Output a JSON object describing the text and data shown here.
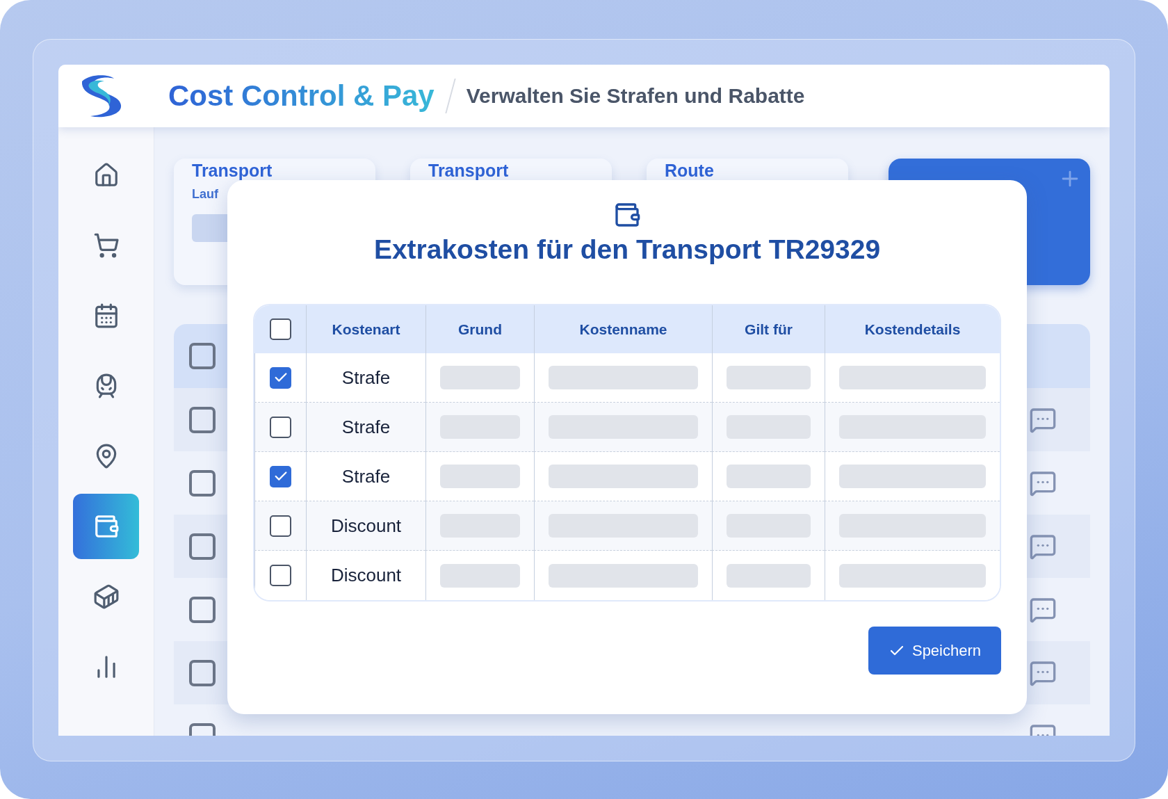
{
  "header": {
    "title": "Cost Control & Pay",
    "subtitle": "Verwalten Sie Strafen und Rabatte"
  },
  "sidebar": {
    "items": [
      {
        "selected": false
      },
      {
        "selected": false
      },
      {
        "selected": false
      },
      {
        "selected": false
      },
      {
        "selected": false
      },
      {
        "selected": true
      },
      {
        "selected": false
      },
      {
        "selected": false
      }
    ]
  },
  "background": {
    "cards": [
      {
        "title": "Transport",
        "subtitle": "Lauf"
      },
      {
        "title": "Transport"
      },
      {
        "title": "Route"
      }
    ],
    "header_checked": false,
    "rows": [
      {
        "checked": false
      },
      {
        "checked": false
      },
      {
        "checked": false
      },
      {
        "checked": false
      },
      {
        "checked": false
      },
      {
        "checked": false
      }
    ]
  },
  "modal": {
    "title": "Extrakosten für den Transport TR29329",
    "table": {
      "header_checked": false,
      "columns": [
        "Kostenart",
        "Grund",
        "Kostenname",
        "Gilt für",
        "Kostendetails"
      ],
      "rows": [
        {
          "checked": true,
          "kostenart": "Strafe"
        },
        {
          "checked": false,
          "kostenart": "Strafe"
        },
        {
          "checked": true,
          "kostenart": "Strafe"
        },
        {
          "checked": false,
          "kostenart": "Discount"
        },
        {
          "checked": false,
          "kostenart": "Discount"
        }
      ]
    },
    "save_button": "Speichern"
  }
}
